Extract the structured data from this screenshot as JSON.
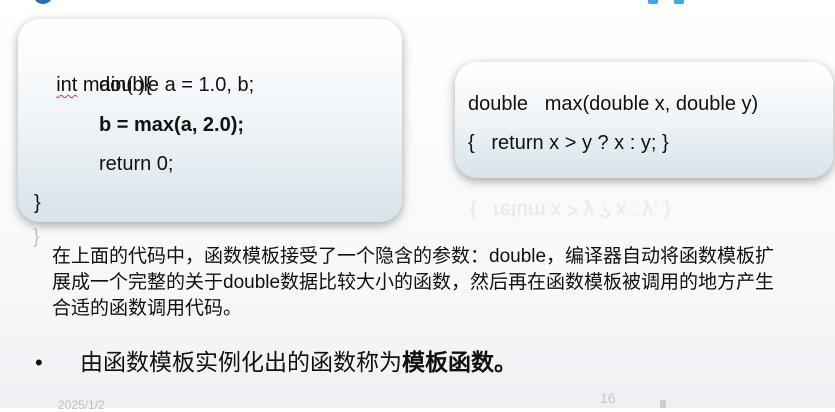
{
  "slide": {
    "main_code": {
      "line1_kw": "int",
      "line1_rest": " main( ){",
      "line2": "double a = 1.0, b;",
      "line3": "b = max(a, 2.0);",
      "line4": "return 0;",
      "line5": "}"
    },
    "max_code": {
      "line1": "double   max(double x, double y)",
      "line2": "{   return x > y ? x : y; }"
    },
    "reflection_text": "{   return x > y ? x : y; }",
    "reflection_brace": "}",
    "paragraph": "在上面的代码中，函数模板接受了一个隐含的参数：double，编译器自动将函数模板扩展成一个完整的关于double数据比较大小的函数，然后再在函数模板被调用的地方产生合适的函数调用代码。",
    "bullet": {
      "symbol": "•",
      "text_normal": "由函数模板实例化出的函数称为",
      "text_bold": "模板函数。"
    },
    "footer": {
      "date": "2025/1/2",
      "page_number": "16"
    }
  },
  "colors": {
    "accent_blue": "#2c6fb4",
    "icon_blue": "#4aa3e0",
    "card_gradient_bottom": "#d7e3ea"
  },
  "icons": [
    "logo-icon",
    "toolbar-icon"
  ]
}
